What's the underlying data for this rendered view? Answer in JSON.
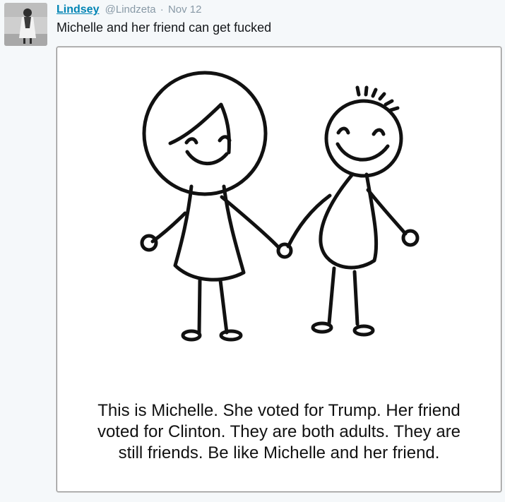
{
  "tweet": {
    "name": "Lindsey",
    "handle": "@Lindzeta",
    "separator": "·",
    "date": "Nov 12",
    "text": "Michelle and her friend can get fucked",
    "avatar_icon": "profile-photo",
    "colors": {
      "name": "#0084b4",
      "meta": "#8899a6",
      "background": "#f5f8fa"
    }
  },
  "media": {
    "drawing": "stick-figure-girl-and-boy-holding-hands",
    "caption_lines": [
      "This is Michelle.  She voted for Trump.  Her friend",
      "voted for Clinton.  They are both adults.  They are",
      "still friends.  Be like Michelle and her friend."
    ]
  }
}
